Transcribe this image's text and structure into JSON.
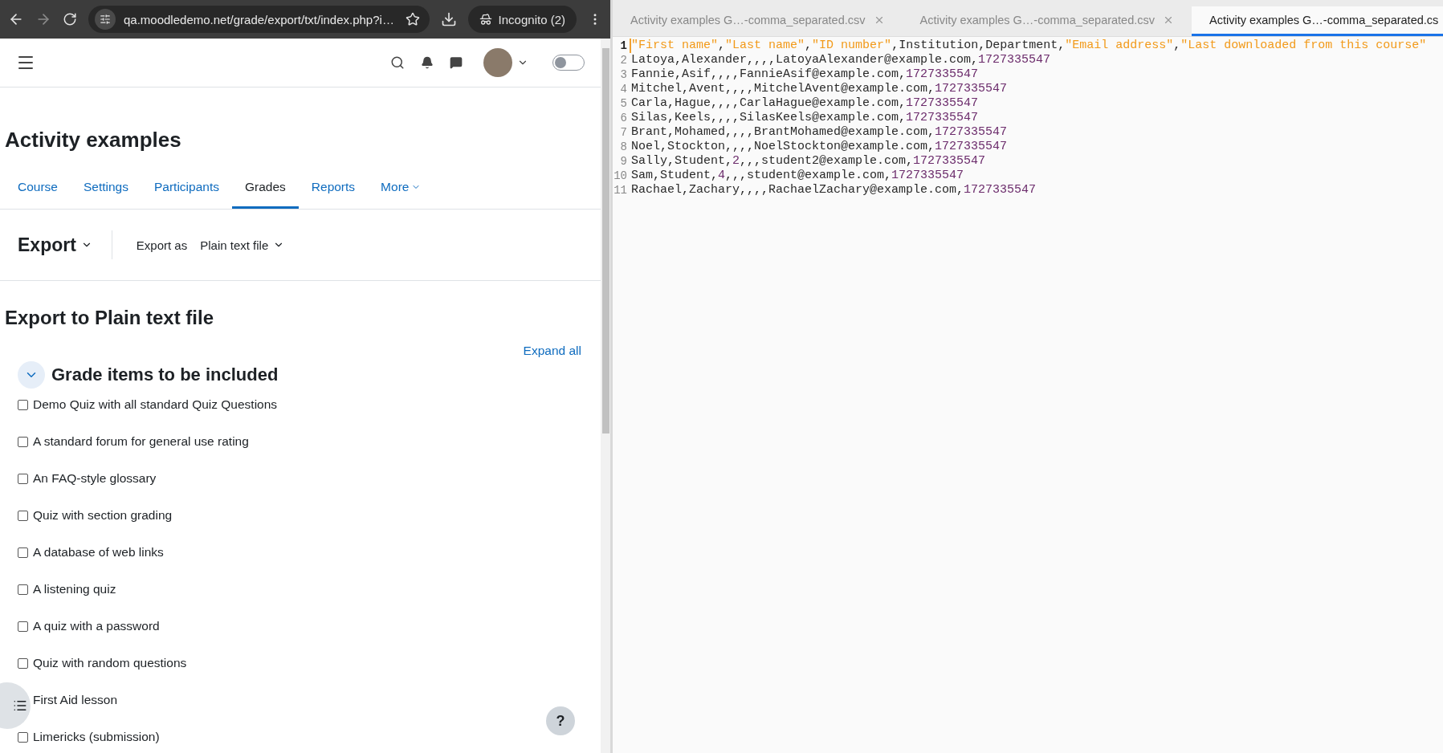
{
  "browser": {
    "url": "qa.moodledemo.net/grade/export/txt/index.php?i…",
    "incognito": "Incognito (2)"
  },
  "header": {
    "dark_mode_toggle": {
      "on": false
    }
  },
  "course_title": "Activity examples",
  "tabs": [
    {
      "label": "Course",
      "selected": false
    },
    {
      "label": "Settings",
      "selected": false
    },
    {
      "label": "Participants",
      "selected": false
    },
    {
      "label": "Grades",
      "selected": true
    },
    {
      "label": "Reports",
      "selected": false
    },
    {
      "label": "More",
      "selected": false,
      "dropdown": true
    }
  ],
  "action_bar": {
    "menu": "Export",
    "export_as_label": "Export as",
    "export_as_value": "Plain text file"
  },
  "page_heading": "Export to Plain text file",
  "expand_all": "Expand all",
  "section": {
    "title": "Grade items to be included",
    "expanded": true,
    "items": [
      {
        "label": "Demo Quiz with all standard Quiz Questions",
        "checked": false
      },
      {
        "label": "A standard forum for general use rating",
        "checked": false
      },
      {
        "label": "An FAQ-style glossary",
        "checked": false
      },
      {
        "label": "Quiz with section grading",
        "checked": false
      },
      {
        "label": "A database of web links",
        "checked": false
      },
      {
        "label": "A listening quiz",
        "checked": false
      },
      {
        "label": "A quiz with a password",
        "checked": false
      },
      {
        "label": "Quiz with random questions",
        "checked": false
      },
      {
        "label": "First Aid lesson"
      },
      {
        "label": "Limericks (submission)",
        "checked": false
      }
    ]
  },
  "help_button": "?",
  "editor": {
    "tabs": [
      {
        "label": "Activity examples G…-comma_separated.csv",
        "selected": false,
        "closable": true
      },
      {
        "label": "Activity examples G…-comma_separated.csv",
        "selected": false,
        "closable": true
      },
      {
        "label": "Activity examples G…-comma_separated.cs",
        "selected": true,
        "closable": false
      }
    ],
    "lines": [
      {
        "number": "1",
        "current": true,
        "tokens": [
          {
            "text": "\"First name\"",
            "kind": "quoted"
          },
          {
            "text": ",",
            "kind": "plain"
          },
          {
            "text": "\"Last name\"",
            "kind": "quoted"
          },
          {
            "text": ",",
            "kind": "plain"
          },
          {
            "text": "\"ID number\"",
            "kind": "quoted"
          },
          {
            "text": ",Institution,Department,",
            "kind": "plain"
          },
          {
            "text": "\"Email address\"",
            "kind": "quoted"
          },
          {
            "text": ",",
            "kind": "plain"
          },
          {
            "text": "\"Last downloaded from this course\"",
            "kind": "quoted"
          }
        ]
      },
      {
        "number": "2",
        "current": false,
        "tokens": [
          {
            "text": "Latoya,Alexander,,,,LatoyaAlexander@example.com,",
            "kind": "plain"
          },
          {
            "text": "1727335547",
            "kind": "number"
          }
        ]
      },
      {
        "number": "3",
        "current": false,
        "tokens": [
          {
            "text": "Fannie,Asif,,,,FannieAsif@example.com,",
            "kind": "plain"
          },
          {
            "text": "1727335547",
            "kind": "number"
          }
        ]
      },
      {
        "number": "4",
        "current": false,
        "tokens": [
          {
            "text": "Mitchel,Avent,,,,MitchelAvent@example.com,",
            "kind": "plain"
          },
          {
            "text": "1727335547",
            "kind": "number"
          }
        ]
      },
      {
        "number": "5",
        "current": false,
        "tokens": [
          {
            "text": "Carla,Hague,,,,CarlaHague@example.com,",
            "kind": "plain"
          },
          {
            "text": "1727335547",
            "kind": "number"
          }
        ]
      },
      {
        "number": "6",
        "current": false,
        "tokens": [
          {
            "text": "Silas,Keels,,,,SilasKeels@example.com,",
            "kind": "plain"
          },
          {
            "text": "1727335547",
            "kind": "number"
          }
        ]
      },
      {
        "number": "7",
        "current": false,
        "tokens": [
          {
            "text": "Brant,Mohamed,,,,BrantMohamed@example.com,",
            "kind": "plain"
          },
          {
            "text": "1727335547",
            "kind": "number"
          }
        ]
      },
      {
        "number": "8",
        "current": false,
        "tokens": [
          {
            "text": "Noel,Stockton,,,,NoelStockton@example.com,",
            "kind": "plain"
          },
          {
            "text": "1727335547",
            "kind": "number"
          }
        ]
      },
      {
        "number": "9",
        "current": false,
        "tokens": [
          {
            "text": "Sally,Student,",
            "kind": "plain"
          },
          {
            "text": "2",
            "kind": "number"
          },
          {
            "text": ",,,student2@example.com,",
            "kind": "plain"
          },
          {
            "text": "1727335547",
            "kind": "number"
          }
        ]
      },
      {
        "number": "10",
        "current": false,
        "tokens": [
          {
            "text": "Sam,Student,",
            "kind": "plain"
          },
          {
            "text": "4",
            "kind": "number"
          },
          {
            "text": ",,,student@example.com,",
            "kind": "plain"
          },
          {
            "text": "1727335547",
            "kind": "number"
          }
        ]
      },
      {
        "number": "11",
        "current": false,
        "tokens": [
          {
            "text": "Rachael,Zachary,,,,RachaelZachary@example.com,",
            "kind": "plain"
          },
          {
            "text": "1727335547",
            "kind": "number"
          }
        ]
      }
    ]
  }
}
